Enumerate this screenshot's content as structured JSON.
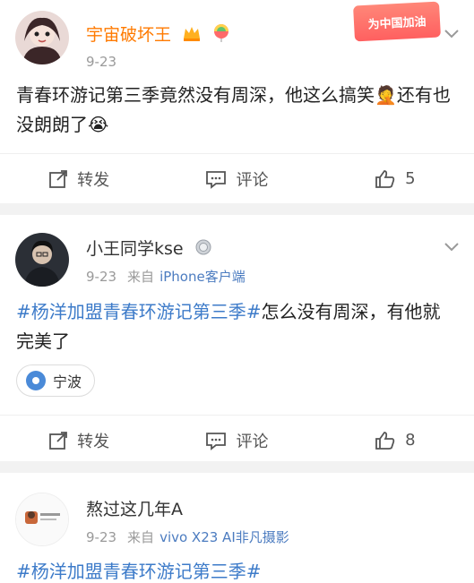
{
  "posts": [
    {
      "username": "宇宙破坏王",
      "date": "9-23",
      "source": "",
      "device": "",
      "stamp": "为中国加油",
      "content_text": "青春环游记第三季竟然没有周深，他这么搞笑🤦还有也没朗朗了😭",
      "location": "",
      "actions": {
        "repost": "转发",
        "comment": "评论",
        "likes": "5"
      }
    },
    {
      "username": "小王同学kse",
      "date": "9-23",
      "source": "来自",
      "device": "iPhone客户端",
      "topic": "#杨洋加盟青春环游记第三季#",
      "content_text": "怎么没有周深，有他就完美了",
      "location": "宁波",
      "actions": {
        "repost": "转发",
        "comment": "评论",
        "likes": "8"
      }
    },
    {
      "username": "熬过这几年A",
      "date": "9-23",
      "source": "来自",
      "device": "vivo X23 AI非凡摄影",
      "topic": "#杨洋加盟青春环游记第三季#",
      "content_text": ""
    }
  ],
  "colors": {
    "vip_name": "#ff7a00",
    "topic": "#3d7bc9",
    "device": "#4c7cc0",
    "meta": "#9a9a9a"
  },
  "icons": [
    "chevron-down-icon",
    "repost-icon",
    "comment-icon",
    "like-icon",
    "location-icon",
    "vip-crown-icon",
    "medal-icon"
  ]
}
